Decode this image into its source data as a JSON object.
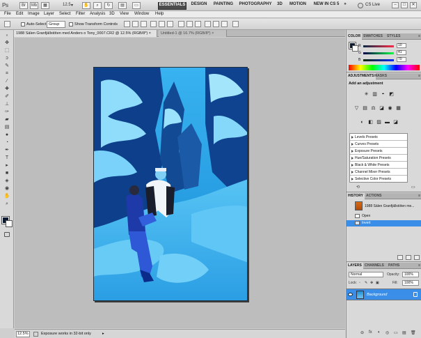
{
  "app": {
    "logo": "Ps",
    "zoom_value": "12.5",
    "zoom_arrow": "▾",
    "workspaces": [
      "ESSENTIALS",
      "DESIGN",
      "PAINTING",
      "PHOTOGRAPHY",
      "3D",
      "MOTION",
      "NEW IN CS 5",
      "»"
    ],
    "cs_live": "CS Live",
    "window_controls": [
      "–",
      "□",
      "✕"
    ]
  },
  "menu": [
    "File",
    "Edit",
    "Image",
    "Layer",
    "Select",
    "Filter",
    "Analysis",
    "3D",
    "View",
    "Window",
    "Help"
  ],
  "options": {
    "auto_select_label": "Auto-Select:",
    "auto_select_value": "Group",
    "transform_label": "Show Transform Controls"
  },
  "documents": {
    "active": "1988 Sälen Granfjällstöten med Anders o Tony_0007.CR2 @ 12.5% (RGB/8*)",
    "inactive": "Untitled-1 @ 16.7% (RGB/8*)",
    "close_glyph": "×"
  },
  "status": {
    "zoom": "12.5%",
    "message": "Exposure works in 32-bit only",
    "arrow": "▸"
  },
  "color_panel": {
    "tabs": [
      "COLOR",
      "SWATCHES",
      "STYLES"
    ],
    "menu_glyph": "≡",
    "sliders": [
      {
        "label": "R",
        "value": "10",
        "color": "#e03030"
      },
      {
        "label": "G",
        "value": "41",
        "color": "#30b030"
      },
      {
        "label": "B",
        "value": "70",
        "color": "#3050e0"
      }
    ],
    "foreground": "#0a1930",
    "background": "#ffffff"
  },
  "adjustments_panel": {
    "tabs": [
      "ADJUSTMENTS",
      "MASKS"
    ],
    "title": "Add an adjustment",
    "icons_row1": [
      "✳",
      "▥",
      "◓",
      "◩"
    ],
    "icons_row2": [
      "▽",
      "▤",
      "⚖",
      "◪",
      "◉",
      "▦"
    ],
    "icons_row3": [
      "◐",
      "◧",
      "▨",
      "▬",
      "◪"
    ],
    "presets": [
      "Levels Presets",
      "Curves Presets",
      "Exposure Presets",
      "Hue/Saturation Presets",
      "Black & White Presets",
      "Channel Mixer Presets",
      "Selective Color Presets"
    ],
    "footer_icons": [
      "⟲",
      "▭"
    ]
  },
  "history_panel": {
    "tabs": [
      "HISTORY",
      "ACTIONS"
    ],
    "snapshot": "1988 Sälen Granfjällstöten me...",
    "items": [
      "Open",
      "Invert"
    ]
  },
  "layers_panel": {
    "tabs": [
      "LAYERS",
      "CHANNELS",
      "PATHS"
    ],
    "blend_mode": "Normal",
    "opacity_label": "Opacity:",
    "opacity_value": "100%",
    "lock_label": "Lock:",
    "fill_label": "Fill:",
    "fill_value": "100%",
    "layer_name": "Background",
    "footer_icons": [
      "⊖",
      "fx",
      "◑",
      "◎",
      "▭",
      "▤",
      "🗑"
    ]
  }
}
